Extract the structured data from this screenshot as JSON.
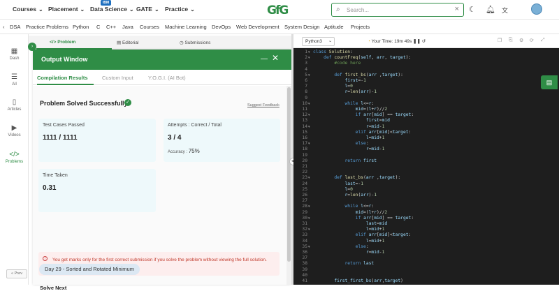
{
  "topnav": {
    "menus": [
      "Courses",
      "Placement",
      "Data Science",
      "GATE",
      "Practice"
    ],
    "badge": "IBM",
    "logo": "GfG",
    "search_placeholder": "Search..."
  },
  "subnav": [
    "DSA",
    "Practice Problems",
    "Python",
    "C",
    "C++",
    "Java",
    "Courses",
    "Machine Learning",
    "DevOps",
    "Web Development",
    "System Design",
    "Aptitude",
    "Projects"
  ],
  "sidebar": {
    "items": [
      {
        "label": "Dash",
        "icon": "grid-icon"
      },
      {
        "label": "All",
        "icon": "list-icon"
      },
      {
        "label": "Articles",
        "icon": "book-icon"
      },
      {
        "label": "Videos",
        "icon": "video-icon"
      },
      {
        "label": "Problems",
        "icon": "code-icon"
      }
    ],
    "prev": "« Prev"
  },
  "problem_tabs": [
    "Problem",
    "Editorial",
    "Submissions"
  ],
  "output_window": {
    "title": "Output Window",
    "tabs": [
      "Compilation Results",
      "Custom Input",
      "Y.O.G.I. (AI Bot)"
    ],
    "heading": "Problem Solved Successfully",
    "feedback": "Suggest Feedback",
    "test_cases_label": "Test Cases Passed",
    "test_cases_value": "1111 / 1111",
    "attempts_label": "Attempts : Correct / Total",
    "attempts_value": "3 / 4",
    "accuracy_label": "Accuracy :",
    "accuracy_value": "75%",
    "time_label": "Time Taken",
    "time_value": "0.31",
    "alert": "You get marks only for the first correct submission if you solve the problem without viewing the full solution.",
    "solve_next": "Solve Next",
    "next_problem": "Day 29 - Sorted and Rotated Minimum"
  },
  "editor": {
    "language": "Python3",
    "timer": "Your Time: 19m 49s",
    "lines": [
      "class Solution:",
      "    def countFreq(self, arr, target):",
      "        #code here",
      "",
      "        def first_bs(arr ,target):",
      "            first=-1",
      "            l=0",
      "            r=len(arr)-1",
      "",
      "            while l<=r:",
      "                mid=(l+r)//2",
      "                if arr[mid] == target:",
      "                    first=mid",
      "                    r=mid-1",
      "                elif arr[mid]<target:",
      "                    l=mid+1",
      "                else:",
      "                    r=mid-1",
      "",
      "            return first",
      "",
      "",
      "        def last_bs(arr ,target):",
      "            last=-1",
      "            l=0",
      "            r=len(arr)-1",
      "",
      "            while l<=r:",
      "                mid=(l+r)//2",
      "                if arr[mid] == target:",
      "                    last=mid",
      "                    l=mid+1",
      "                elif arr[mid]<target:",
      "                    l=mid+1",
      "                else:",
      "                    r=mid-1",
      "",
      "            return last",
      "",
      "",
      "        first_first_bs(arr,target)"
    ]
  },
  "colors": {
    "brand_green": "#2f8d46",
    "editor_bg": "#1e1e1e",
    "alert_text": "#c0392b"
  }
}
